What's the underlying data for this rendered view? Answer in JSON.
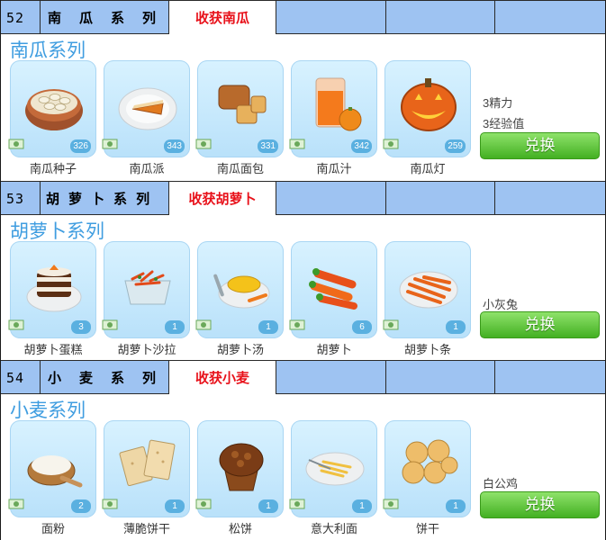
{
  "sections": [
    {
      "number": "52",
      "name_chars": [
        "南",
        "瓜",
        "系",
        "列"
      ],
      "harvest": "收获南瓜",
      "title": "南瓜系列",
      "items": [
        {
          "name": "南瓜种子",
          "count": "326",
          "icon": "pumpkin-seeds-icon"
        },
        {
          "name": "南瓜派",
          "count": "343",
          "icon": "pumpkin-pie-icon"
        },
        {
          "name": "南瓜面包",
          "count": "331",
          "icon": "pumpkin-bread-icon"
        },
        {
          "name": "南瓜汁",
          "count": "342",
          "icon": "pumpkin-juice-icon"
        },
        {
          "name": "南瓜灯",
          "count": "259",
          "icon": "jack-o-lantern-icon"
        }
      ],
      "requirements": [
        "3精力",
        "3经验值"
      ],
      "button": "兑换"
    },
    {
      "number": "53",
      "name_chars": [
        "胡",
        "萝",
        "卜",
        "系",
        "列"
      ],
      "harvest": "收获胡萝卜",
      "title": "胡萝卜系列",
      "items": [
        {
          "name": "胡萝卜蛋糕",
          "count": "3",
          "icon": "carrot-cake-icon"
        },
        {
          "name": "胡萝卜沙拉",
          "count": "1",
          "icon": "carrot-salad-icon"
        },
        {
          "name": "胡萝卜汤",
          "count": "1",
          "icon": "carrot-soup-icon"
        },
        {
          "name": "胡萝卜",
          "count": "6",
          "icon": "carrot-icon"
        },
        {
          "name": "胡萝卜条",
          "count": "1",
          "icon": "carrot-sticks-icon"
        }
      ],
      "requirements": [
        "小灰兔"
      ],
      "button": "兑换"
    },
    {
      "number": "54",
      "name_chars": [
        "小",
        "麦",
        "系",
        "列"
      ],
      "harvest": "收获小麦",
      "title": "小麦系列",
      "items": [
        {
          "name": "面粉",
          "count": "2",
          "icon": "flour-icon"
        },
        {
          "name": "薄脆饼干",
          "count": "1",
          "icon": "crackers-icon"
        },
        {
          "name": "松饼",
          "count": "1",
          "icon": "muffin-icon"
        },
        {
          "name": "意大利面",
          "count": "1",
          "icon": "pasta-icon"
        },
        {
          "name": "饼干",
          "count": "1",
          "icon": "biscuits-icon"
        }
      ],
      "requirements": [
        "白公鸡"
      ],
      "button": "兑换"
    }
  ],
  "colors": {
    "header_bg": "#9ec3f2",
    "harvest_text": "#e8111a",
    "title_text": "#3f9de0",
    "button_green": "#43b022"
  }
}
